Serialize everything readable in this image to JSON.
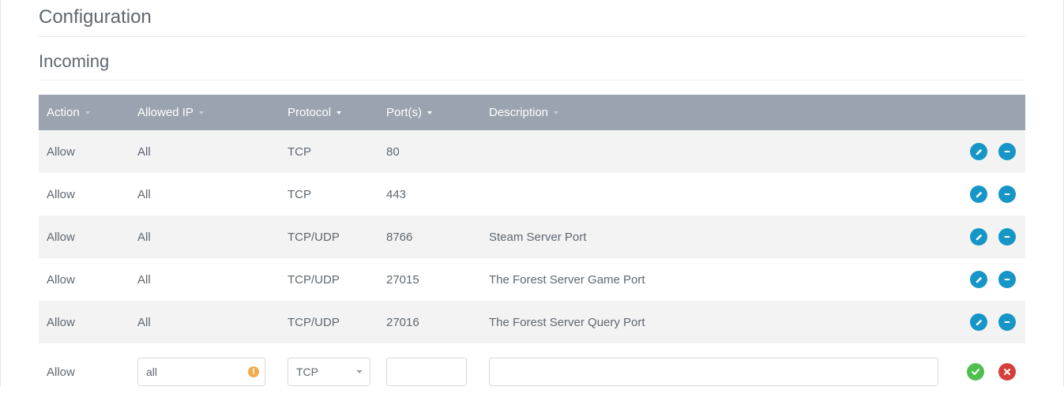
{
  "headings": {
    "configuration": "Configuration",
    "incoming": "Incoming"
  },
  "columns": {
    "action": "Action",
    "allowed_ip": "Allowed IP",
    "protocol": "Protocol",
    "ports": "Port(s)",
    "description": "Description"
  },
  "rows": [
    {
      "action": "Allow",
      "ip": "All",
      "protocol": "TCP",
      "ports": "80",
      "description": ""
    },
    {
      "action": "Allow",
      "ip": "All",
      "protocol": "TCP",
      "ports": "443",
      "description": ""
    },
    {
      "action": "Allow",
      "ip": "All",
      "protocol": "TCP/UDP",
      "ports": "8766",
      "description": "Steam Server Port"
    },
    {
      "action": "Allow",
      "ip": "All",
      "protocol": "TCP/UDP",
      "ports": "27015",
      "description": "The Forest Server Game Port"
    },
    {
      "action": "Allow",
      "ip": "All",
      "protocol": "TCP/UDP",
      "ports": "27016",
      "description": "The Forest Server Query Port"
    }
  ],
  "input_row": {
    "action": "Allow",
    "ip_value": "all",
    "protocol_selected": "TCP",
    "ports_value": "",
    "description_value": ""
  }
}
